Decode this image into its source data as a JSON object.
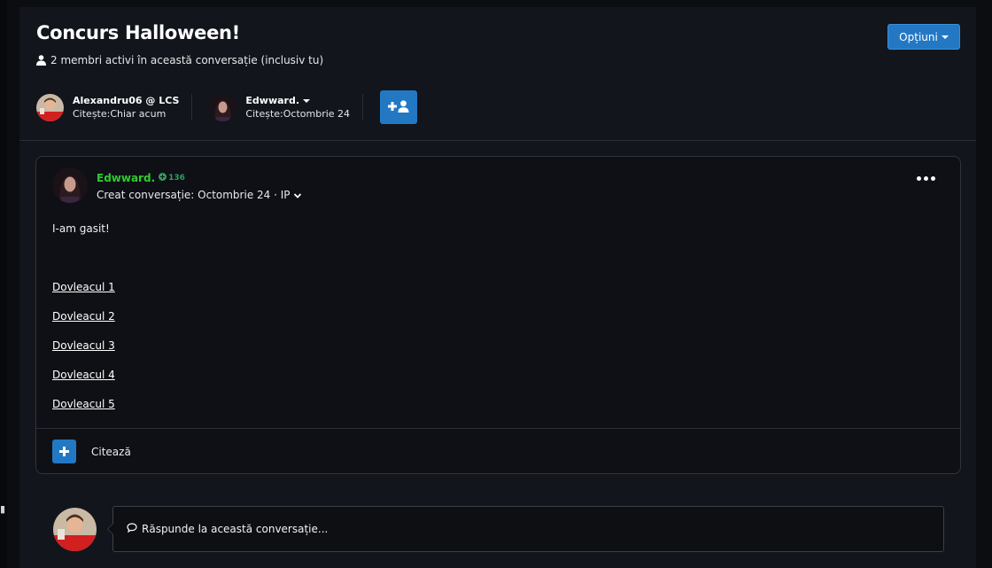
{
  "conversation": {
    "title": "Concurs Halloween!",
    "members_text": "2 membri activi în această conversație (inclusiv tu)",
    "options_label": "Opțiuni"
  },
  "participants": [
    {
      "name": "Alexandru06 @ LCS",
      "status": "Citește:Chiar acum",
      "avatar": "avatar-alexandru"
    },
    {
      "name": "Edwward.",
      "status": "Citește:Octombrie 24",
      "avatar": "avatar-edwward"
    }
  ],
  "post": {
    "author": "Edwward.",
    "reputation": "136",
    "meta": "Creat conversație: Octombrie 24 · IP",
    "text": "I-am gasit!",
    "links": [
      "Dovleacul 1",
      "Dovleacul 2",
      "Dovleacul 3",
      "Dovleacul 4",
      "Dovleacul 5"
    ],
    "quote_label": "Citează"
  },
  "reply": {
    "placeholder": "Răspunde la această conversație..."
  },
  "colors": {
    "accent": "#2378c4",
    "author_green": "#2ecc2e",
    "background": "#12151b"
  },
  "icons": [
    "user-icon",
    "caret-down-icon",
    "add-user-icon",
    "reputation-icon",
    "more-icon",
    "plus-icon",
    "comment-icon"
  ]
}
